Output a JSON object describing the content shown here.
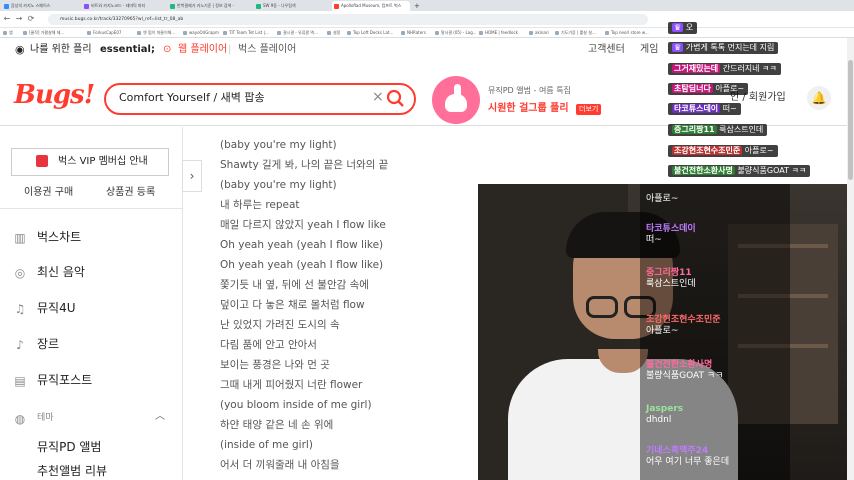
{
  "browser": {
    "tabs": [
      {
        "label": "음성의 카지노 스페이스",
        "color": "#2f8cff"
      },
      {
        "label": "비트와 카지노코드 - 테마틱 파티",
        "color": "#8a4fff"
      },
      {
        "label": "반복결제가 카노기준 | 정보 검색 -",
        "color": "#1eb980"
      },
      {
        "label": "SW 9동 - 나우탐색",
        "color": "#1eb980"
      },
      {
        "label": "Apolloflad Museum, 컴프트 벅스",
        "color": "#ff3c2f"
      }
    ],
    "url": "music.bugs.co.kr/track/33270965?wl_ref=list_tr_08_ab",
    "bookmarks": [
      "앱",
      "[쿨작] 가평살해 제...",
      "ForkusCapE07",
      "옛 펌이 마물이해...",
      "wayoO4Grapm",
      "TIT Team Tet List |...",
      "결시결 - 유류팔 엑...",
      "설정",
      "Top Loft Decks Lat...",
      "NHRaters",
      "탈사결 (05) - Lag...",
      "HOME | feedlock",
      "akinari",
      "기도기증 | 롤살 설...",
      "Top neorl store w..."
    ]
  },
  "gnb": {
    "for_me": "나를 위한 플리",
    "essential": "essential;",
    "web_player": "웹 플레이어",
    "bugs_player": "벅스 플레이어",
    "customer_center": "고객센터",
    "game": "게임"
  },
  "header": {
    "logo": "Bugs!",
    "search_query": "Comfort Yourself / 새벽 팝송",
    "promo_subtitle": "뮤직PD 앨범 - 여름 특집",
    "promo_title": "시원한 걸그룹 플리",
    "promo_more": "더보기",
    "login": "인 / 회원가입"
  },
  "sidebar": {
    "vip_banner": "벅스 VIP 멤버십 안내",
    "buy_ticket": "이용권 구매",
    "register_voucher": "상품권 등록",
    "menu": [
      {
        "label": "벅스차트",
        "icon": "chart-icon"
      },
      {
        "label": "최신 음악",
        "icon": "new-music-icon"
      },
      {
        "label": "뮤직4U",
        "icon": "music-note-icon"
      },
      {
        "label": "장르",
        "icon": "guitar-icon"
      },
      {
        "label": "뮤직포스트",
        "icon": "post-icon"
      }
    ],
    "theme_label": "테마",
    "sub_menu": [
      "뮤직PD 앨범",
      "추천앨범 리뷰"
    ]
  },
  "lyrics": [
    "(baby you're my light)",
    "Shawty 길게 봐, 나의 끝은 너와의 끝",
    "(baby you're my light)",
    "내 하루는 repeat",
    "매일 다르지 않았지 yeah I flow like",
    "Oh yeah yeah (yeah I flow like)",
    "Oh yeah yeah (yeah I flow like)",
    "쫓기듯 내 옆, 뒤에 선 불안감 속에",
    "덮이고 다 놓은 채로 몰처럼 flow",
    "난 있었지 가려진 도시의 속",
    "다림 품에 안고 안아서",
    "보이는 풍경은 나와 먼 곳",
    "그때 내게 피어줬지 너란 flower",
    "(you bloom inside of me girl)",
    "하얀 태양 같은 네 손 위에",
    "(inside of me girl)",
    "어서 더 끼워줄래 내 아침을"
  ],
  "top_chat": [
    {
      "name": "",
      "msg": "오",
      "color": "#b48cff"
    },
    {
      "name": "",
      "msg": "가볍게 톡톡 먼지는데 지림",
      "color": "#ff8c42"
    },
    {
      "name": "그거재밌는데",
      "msg": "간드러지네 ㅋㅋ",
      "color": "#ff5fb0"
    },
    {
      "name": "초탐딤너다",
      "msg": "아플로~",
      "color": "#ff5fb0"
    },
    {
      "name": "타코튜스데이",
      "msg": "떠~",
      "color": "#c07cff"
    },
    {
      "name": "중그리짱11",
      "msg": "룩삼스트인데",
      "color": "#6cd36c"
    },
    {
      "name": "조강현조현수조민준",
      "msg": "아플로~",
      "color": "#ff6b6b"
    },
    {
      "name": "불건전한소환사명",
      "msg": "불량식품GOAT ㅋㅋ",
      "color": "#6cd36c"
    }
  ],
  "chat": [
    {
      "name": "",
      "msg": "아플로~",
      "color": "#ffffff"
    },
    {
      "name": "타코튜스데이",
      "msg": "떠~",
      "color": "#c07cff"
    },
    {
      "name": "중그리짱11",
      "msg": "룩삼스트인데",
      "color": "#ff6b9d"
    },
    {
      "name": "조강현조현수조민준",
      "msg": "아플로~",
      "color": "#ff6b6b"
    },
    {
      "name": "불건전한소환사명",
      "msg": "불량식품GOAT ㅋㅋ",
      "color": "#ff6b9d"
    },
    {
      "name": "Jaspers",
      "msg": "dhdnl",
      "color": "#9be39b"
    },
    {
      "name": "기네스흑맥주24",
      "msg": "어우 여기 너무 좋은데",
      "color": "#c07cff"
    }
  ],
  "colors": {
    "accent": "#ff3c2f"
  }
}
